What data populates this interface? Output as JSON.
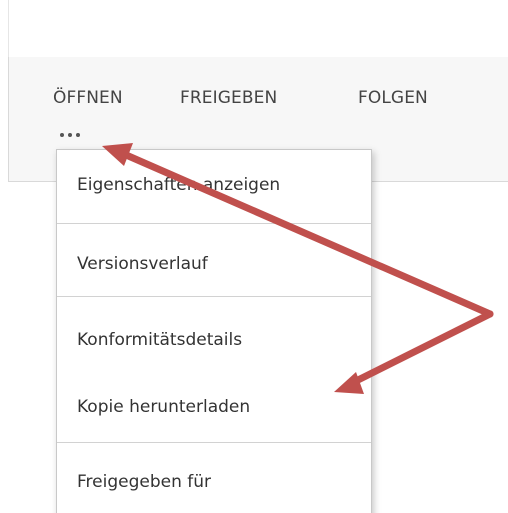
{
  "ribbon": {
    "actions": {
      "open": "ÖFFNEN",
      "share": "FREIGEBEN",
      "follow": "FOLGEN"
    },
    "more_icon": "ellipsis-icon"
  },
  "menu": {
    "items": [
      "Eigenschaften anzeigen",
      "Versionsverlauf",
      "Konformitätsdetails",
      "Kopie herunterladen",
      "Freigegeben für"
    ]
  },
  "annotation": {
    "arrow_color": "#c0504d"
  },
  "colors": {
    "action_text": "#444444",
    "menu_text": "#333333",
    "bar_background": "#f7f7f7",
    "separator": "#d2d2d2"
  }
}
